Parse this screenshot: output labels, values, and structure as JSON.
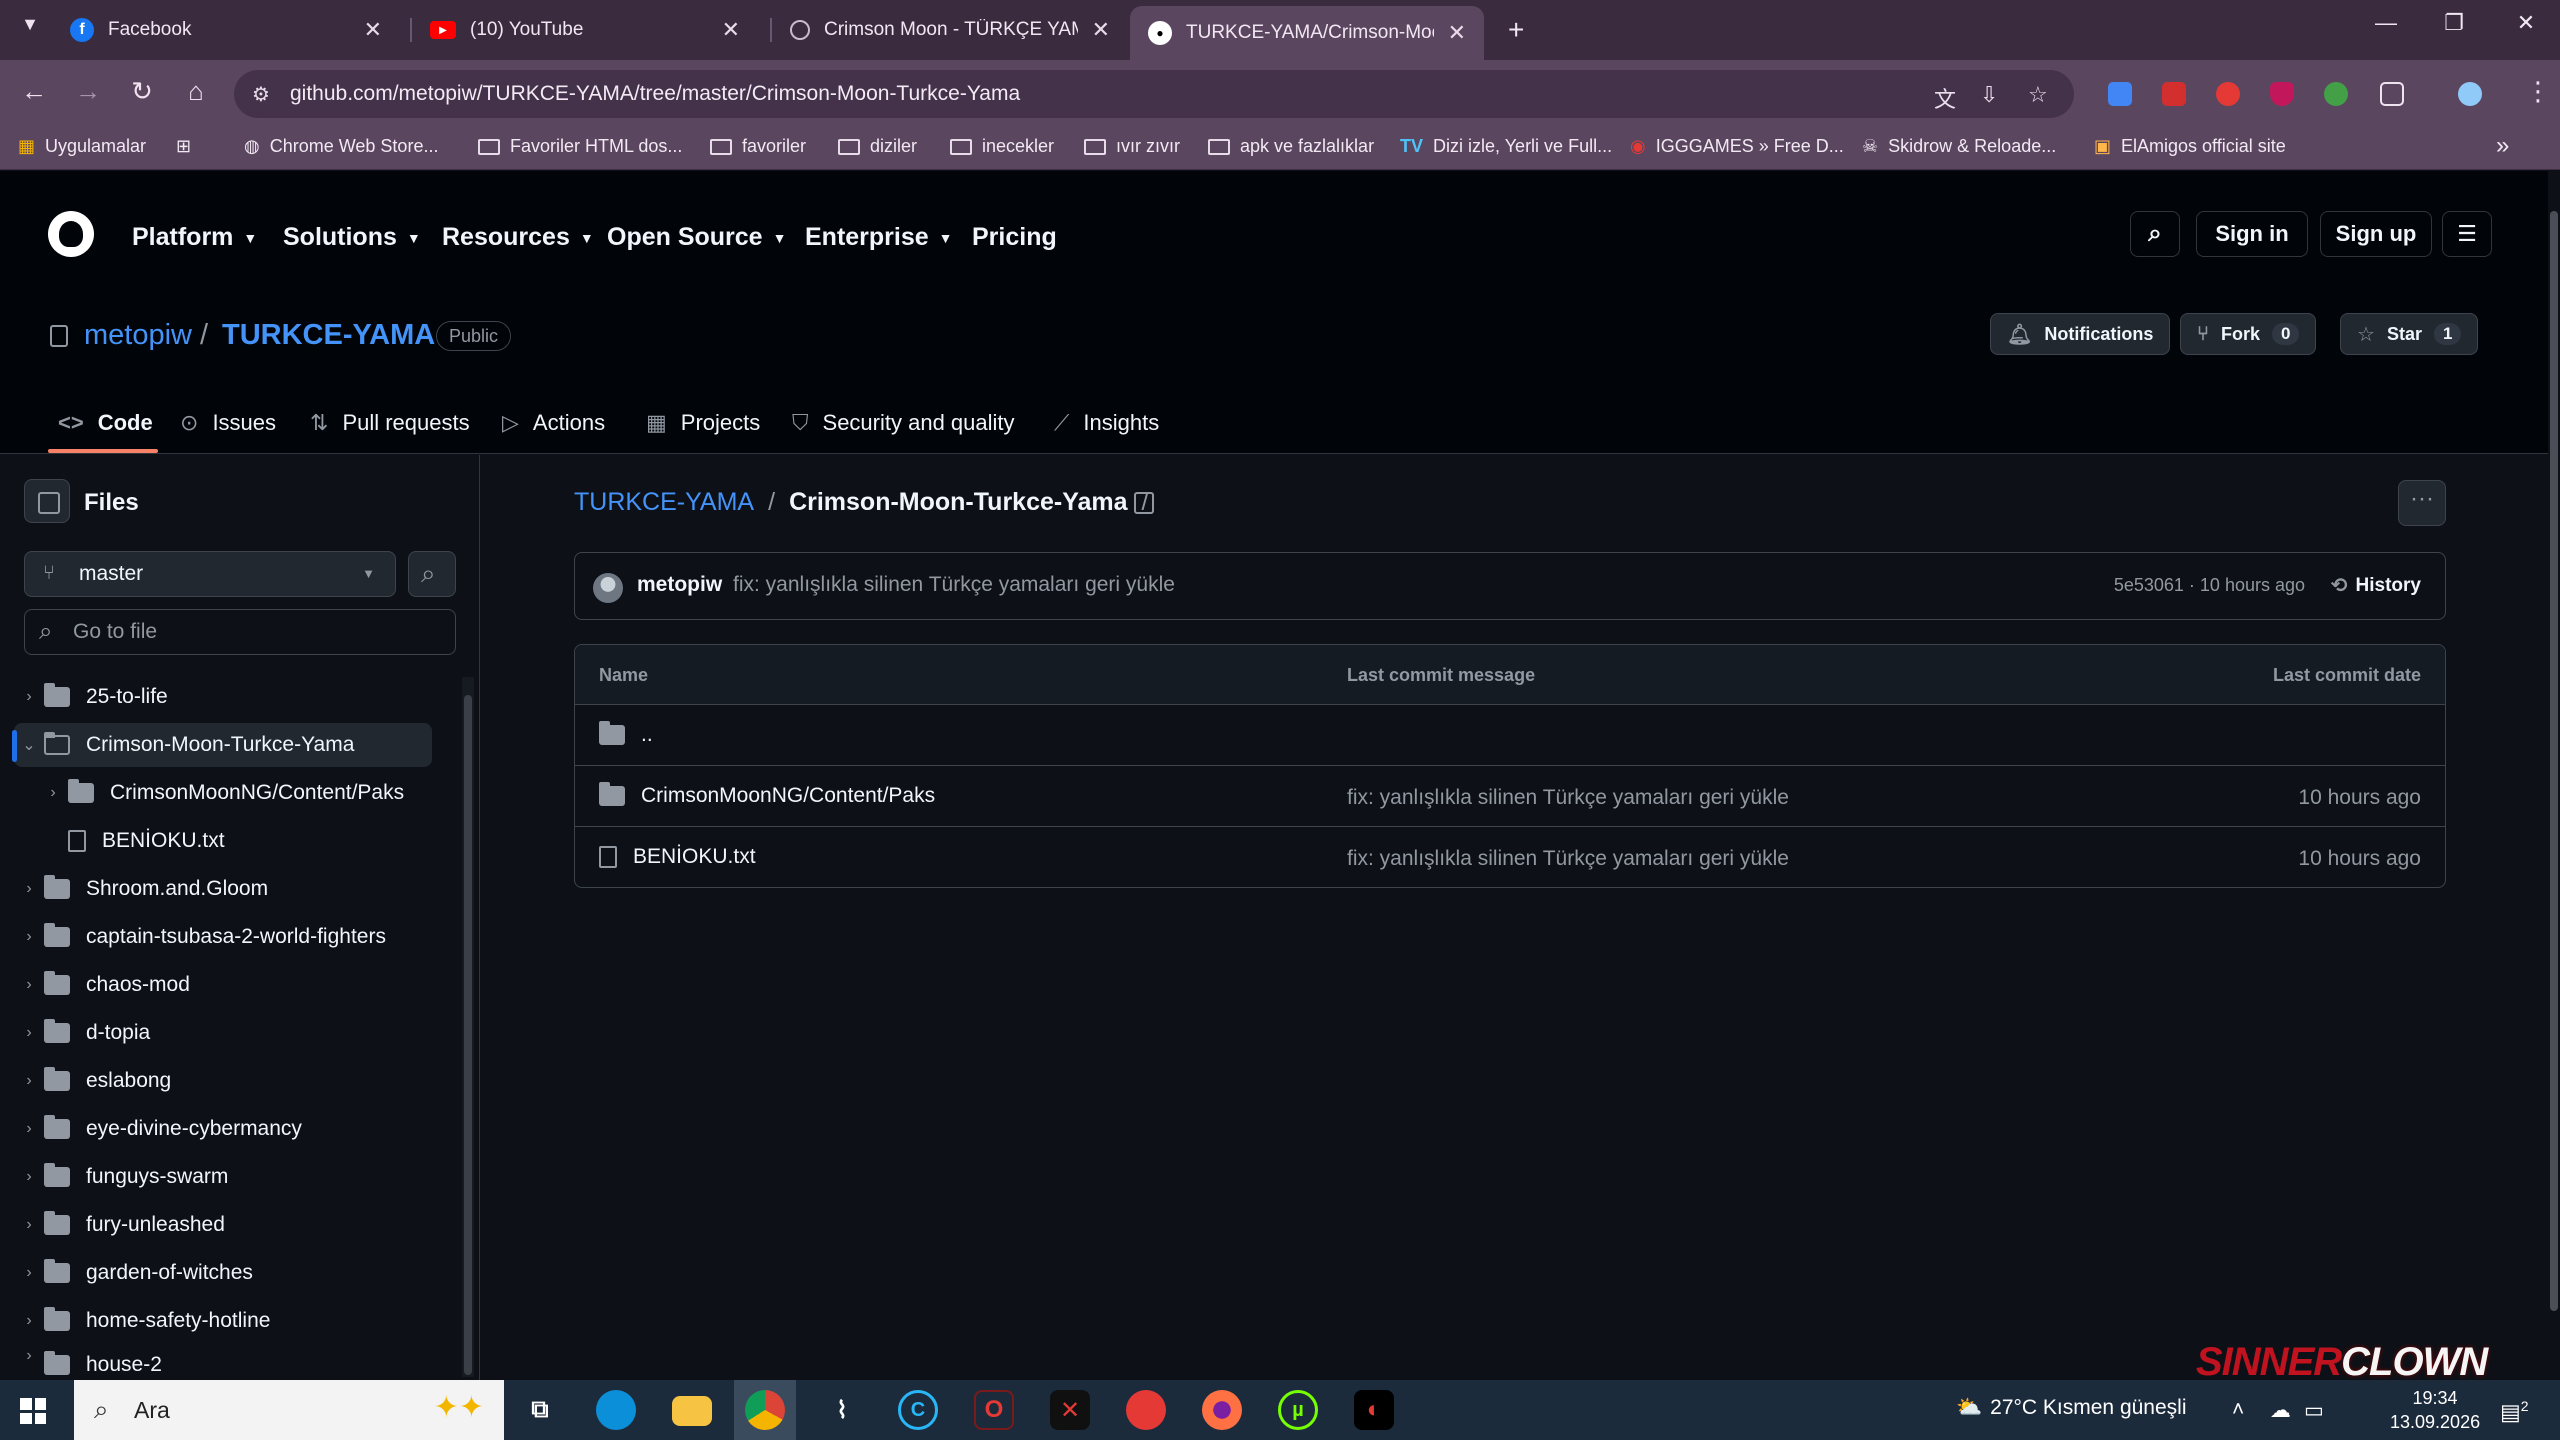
{
  "browser": {
    "tabs": [
      {
        "title": "Facebook",
        "icon": "facebook-icon",
        "color": "#1877f2"
      },
      {
        "title": "(10) YouTube",
        "icon": "youtube-icon",
        "color": "#ff0000"
      },
      {
        "title": "Crimson Moon - TÜRKÇE YAMA",
        "icon": "globe-icon",
        "color": "#9aa0a6"
      },
      {
        "title": "TURKCE-YAMA/Crimson-Moon-Turkce-Yama",
        "icon": "github-icon",
        "color": "#ffffff"
      }
    ],
    "new_tab": "+",
    "url": "github.com/metopiw/TURKCE-YAMA/tree/master/Crimson-Moon-Turkce-Yama",
    "bookmarks": [
      "Uygulamalar",
      "Chrome Web Store...",
      "Favoriler HTML dos...",
      "favoriler",
      "diziler",
      "inecekler",
      "ıvır zıvır",
      "apk ve fazlalıklar",
      "Dizi izle, Yerli ve Full...",
      "IGGGAMES » Free D...",
      "Skidrow & Reloade...",
      "ElAmigos official site"
    ],
    "more": "»"
  },
  "gh": {
    "nav": [
      "Platform",
      "Solutions",
      "Resources",
      "Open Source",
      "Enterprise",
      "Pricing"
    ],
    "sign_in": "Sign in",
    "sign_up": "Sign up"
  },
  "repo": {
    "owner": "metopiw",
    "slash": "/",
    "name": "TURKCE-YAMA",
    "visibility": "Public",
    "notifications": "Notifications",
    "fork": "Fork",
    "fork_count": "0",
    "star": "Star",
    "star_count": "1",
    "tabs": [
      "Code",
      "Issues",
      "Pull requests",
      "Actions",
      "Projects",
      "Security and quality",
      "Insights"
    ]
  },
  "sidebar": {
    "title": "Files",
    "branch": "master",
    "go_to_file": "Go to file",
    "tree": [
      {
        "name": "25-to-life",
        "type": "folder"
      },
      {
        "name": "Crimson-Moon-Turkce-Yama",
        "type": "folder-open"
      },
      {
        "name": "CrimsonMoonNG/Content/Paks",
        "type": "folder"
      },
      {
        "name": "BENİOKU.txt",
        "type": "file"
      },
      {
        "name": "Shroom.and.Gloom",
        "type": "folder"
      },
      {
        "name": "captain-tsubasa-2-world-fighters",
        "type": "folder"
      },
      {
        "name": "chaos-mod",
        "type": "folder"
      },
      {
        "name": "d-topia",
        "type": "folder"
      },
      {
        "name": "eslabong",
        "type": "folder"
      },
      {
        "name": "eye-divine-cybermancy",
        "type": "folder"
      },
      {
        "name": "funguys-swarm",
        "type": "folder"
      },
      {
        "name": "fury-unleashed",
        "type": "folder"
      },
      {
        "name": "garden-of-witches",
        "type": "folder"
      },
      {
        "name": "home-safety-hotline",
        "type": "folder"
      },
      {
        "name": "house-2",
        "type": "folder"
      }
    ]
  },
  "main": {
    "breadcrumb_root": "TURKCE-YAMA",
    "breadcrumb_sep": "/",
    "breadcrumb_current": "Crimson-Moon-Turkce-Yama",
    "commit": {
      "author": "metopiw",
      "message": "fix: yanlışlıkla silinen Türkçe yamaları geri yükle",
      "sha_time": "5e53061 · 10 hours ago",
      "history": "History"
    },
    "table": {
      "col_name": "Name",
      "col_msg": "Last commit message",
      "col_date": "Last commit date",
      "rows": [
        {
          "name": "..",
          "type": "folder",
          "message": "",
          "date": ""
        },
        {
          "name": "CrimsonMoonNG/Content/Paks",
          "type": "folder",
          "message": "fix: yanlışlıkla silinen Türkçe yamaları geri yükle",
          "date": "10 hours ago"
        },
        {
          "name": "BENİOKU.txt",
          "type": "file",
          "message": "fix: yanlışlıkla silinen Türkçe yamaları geri yükle",
          "date": "10 hours ago"
        }
      ]
    }
  },
  "watermark": {
    "part1": "SINNER",
    "part2": "CLOWN"
  },
  "taskbar": {
    "search": "Ara",
    "weather": "27°C  Kısmen güneşli",
    "time": "19:34",
    "date": "13.09.2026",
    "notif_count": "2"
  }
}
